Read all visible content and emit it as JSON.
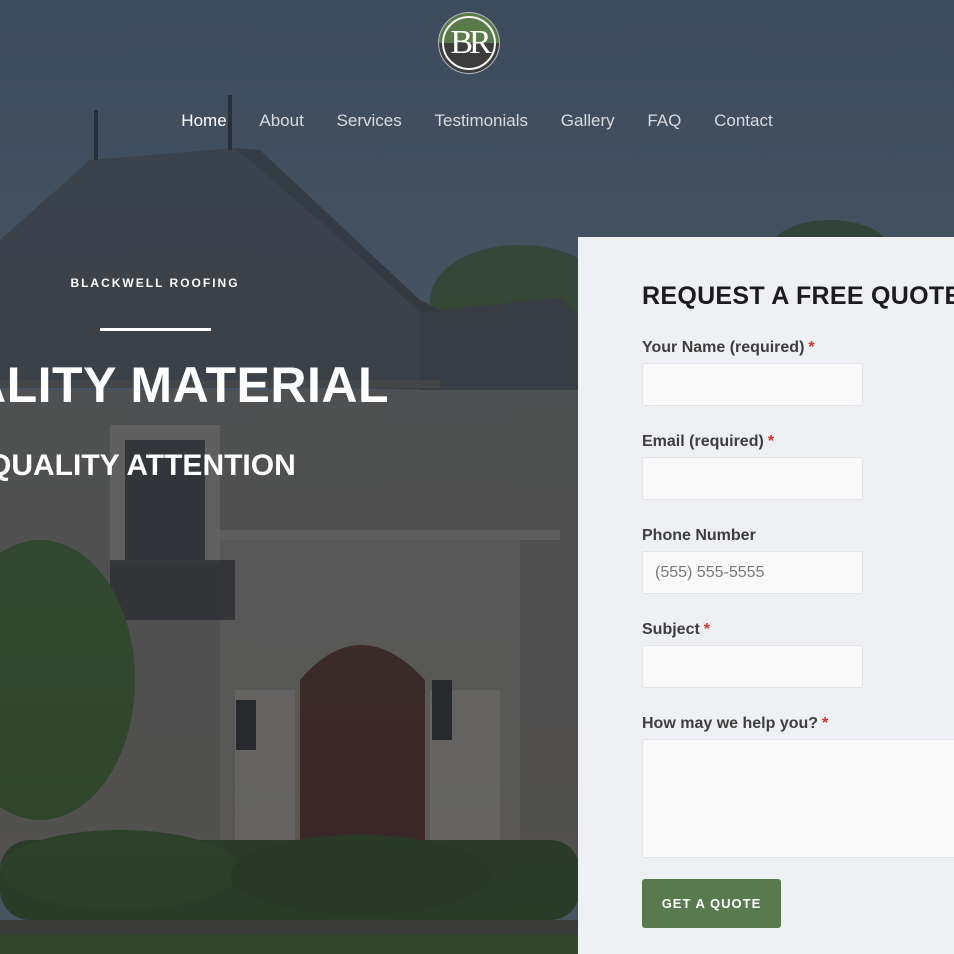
{
  "logo": {
    "letters": "BR",
    "colors": {
      "top": "#5b7a4a",
      "bottom": "#3c3c3c"
    }
  },
  "nav": {
    "items": [
      "Home",
      "About",
      "Services",
      "Testimonials",
      "Gallery",
      "FAQ",
      "Contact"
    ],
    "active": "Home"
  },
  "hero": {
    "kicker": "BLACKWELL ROOFING",
    "headline": "ALITY MATERIAL",
    "subheadline": "QUALITY ATTENTION"
  },
  "quote_form": {
    "title": "REQUEST A FREE QUOTE",
    "fields": {
      "name": {
        "label": "Your Name (required)",
        "required_mark": "*",
        "value": ""
      },
      "email": {
        "label": "Email (required)",
        "required_mark": "*",
        "value": ""
      },
      "phone": {
        "label": "Phone Number",
        "placeholder": "(555) 555-5555",
        "value": ""
      },
      "subject": {
        "label": "Subject",
        "required_mark": "*",
        "value": ""
      },
      "message": {
        "label": "How may we help you?",
        "required_mark": "*",
        "value": ""
      }
    },
    "submit_label": "GET A QUOTE"
  },
  "colors": {
    "accent": "#587a4c",
    "panel": "#eef0f3",
    "required": "#d9302a"
  }
}
